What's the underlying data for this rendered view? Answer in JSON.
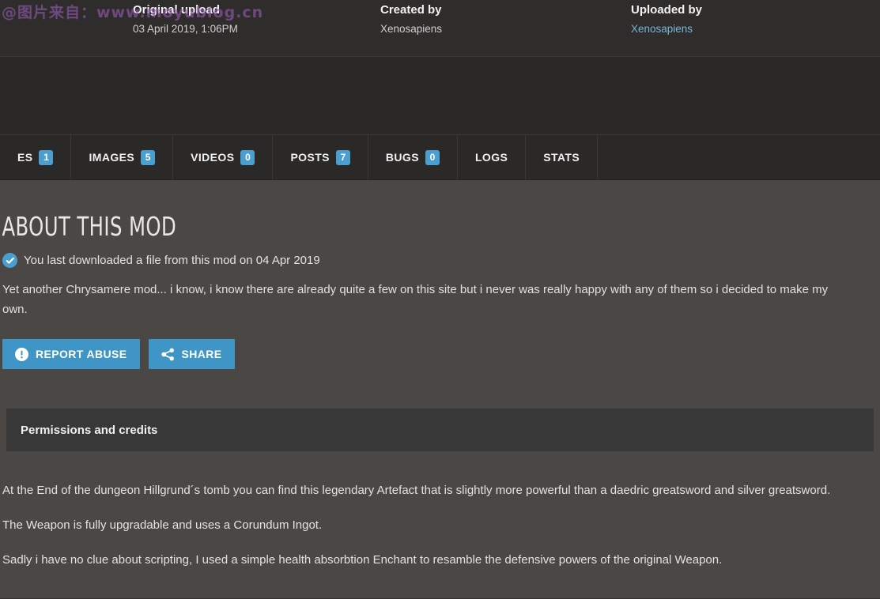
{
  "watermark": {
    "text": "@图片来自：www.moyublog.cn"
  },
  "header": {
    "columns": [
      {
        "label": "Original upload",
        "value": "03 April 2019,  1:06PM",
        "is_link": false
      },
      {
        "label": "Created by",
        "value": "Xenosapiens",
        "is_link": false
      },
      {
        "label": "Uploaded by",
        "value": "Xenosapiens",
        "is_link": true
      }
    ]
  },
  "tabs": [
    {
      "label": "ES",
      "badge": "1"
    },
    {
      "label": "IMAGES",
      "badge": "5"
    },
    {
      "label": "VIDEOS",
      "badge": "0"
    },
    {
      "label": "POSTS",
      "badge": "7"
    },
    {
      "label": "BUGS",
      "badge": "0"
    },
    {
      "label": "LOGS",
      "badge": null
    },
    {
      "label": "STATS",
      "badge": null
    }
  ],
  "main": {
    "heading": "ABOUT THIS MOD",
    "download_notice": "You last downloaded a file from this mod on 04 Apr 2019",
    "description": "Yet another Chrysamere mod... i know, i know there are already quite a few on this site but i never was really happy with any of them so i decided to make my own.",
    "buttons": [
      {
        "label": "REPORT ABUSE",
        "icon": "exclamation-circle-icon"
      },
      {
        "label": "SHARE",
        "icon": "share-icon"
      }
    ],
    "permissions_title": "Permissions and credits",
    "paragraphs": [
      "At the End of the dungeon Hillgrund´s tomb you can find this legendary Artefact that is slightly more powerful than a daedric greatsword and silver greatsword.",
      "The Weapon is fully upgradable and uses a Corundum Ingot.",
      "Sadly i have no clue about scripting, I used a simple health absorbtion Enchant to resamble the defensive powers of the original Weapon."
    ]
  },
  "colors": {
    "accent": "#4b9fd0",
    "button": "#3f95c6",
    "top_bg": "#2f2d2c",
    "tab_bg": "#2b2928",
    "content_bg": "#4a4745",
    "panel_bg": "#383838",
    "link": "#78b5d4"
  }
}
